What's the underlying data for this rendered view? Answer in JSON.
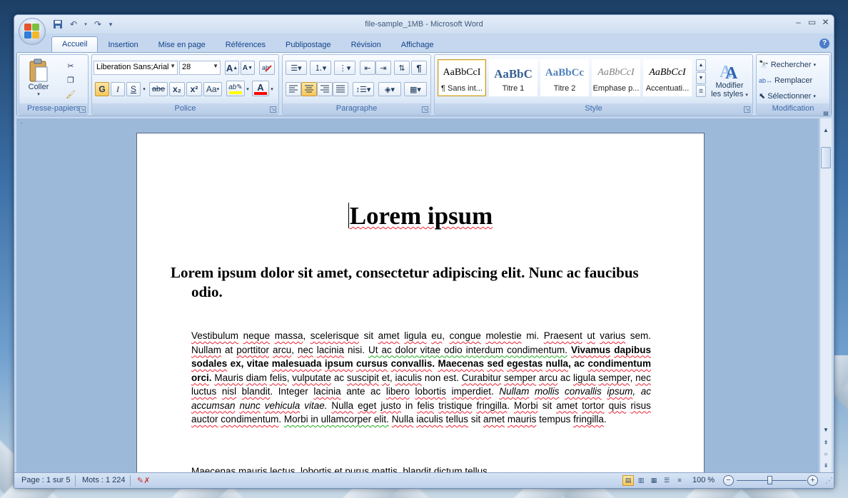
{
  "window": {
    "title": "file-sample_1MB - Microsoft Word"
  },
  "qat": {
    "save_icon": "save-icon",
    "undo_icon": "undo-icon",
    "redo_icon": "redo-icon",
    "customize_icon": "dropdown-icon"
  },
  "tabs": [
    {
      "label": "Accueil",
      "active": true
    },
    {
      "label": "Insertion"
    },
    {
      "label": "Mise en page"
    },
    {
      "label": "Références"
    },
    {
      "label": "Publipostage"
    },
    {
      "label": "Révision"
    },
    {
      "label": "Affichage"
    }
  ],
  "groups": {
    "clipboard": {
      "label": "Presse-papiers",
      "paste_label": "Coller"
    },
    "font": {
      "label": "Police",
      "font_name": "Liberation Sans;Arial",
      "font_size": "28",
      "bold": "G",
      "italic": "I",
      "underline": "S",
      "strike": "abe",
      "subscript": "x₂",
      "superscript": "x²",
      "case": "Aa",
      "grow": "A",
      "shrink": "A"
    },
    "paragraph": {
      "label": "Paragraphe"
    },
    "style": {
      "label": "Style",
      "tiles": [
        {
          "sample": "AaBbCcI",
          "name": "¶ Sans int...",
          "active": true
        },
        {
          "sample": "AaBbC",
          "name": "Titre 1"
        },
        {
          "sample": "AaBbCc",
          "name": "Titre 2"
        },
        {
          "sample": "AaBbCcI",
          "name": "Emphase p..."
        },
        {
          "sample": "AaBbCcI",
          "name": "Accentuati..."
        }
      ],
      "change_styles_line1": "Modifier",
      "change_styles_line2": "les styles"
    },
    "editing": {
      "label": "Modification",
      "find": "Rechercher",
      "replace": "Remplacer",
      "select": "Sélectionner"
    }
  },
  "document": {
    "title": "Lorem ipsum",
    "heading": "Lorem ipsum dolor sit amet, consectetur adipiscing elit. Nunc ac faucibus odio.",
    "next_line": "Maecenas mauris lectus, lobortis et purus mattis, blandit dictum tellus."
  },
  "status": {
    "page": "Page : 1 sur 5",
    "words": "Mots : 1 224",
    "zoom": "100 %"
  },
  "colors": {
    "highlight": "#ffff00",
    "font_color": "#ff0000",
    "accent": "#15428b"
  }
}
